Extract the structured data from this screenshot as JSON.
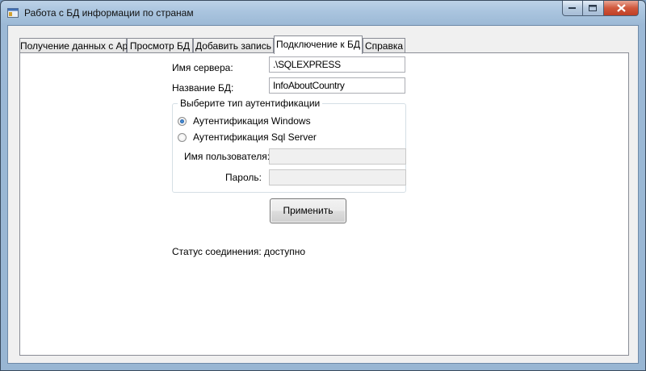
{
  "window": {
    "title": "Работа с БД информации по странам"
  },
  "tabs": [
    {
      "label": "Получение данных с Api"
    },
    {
      "label": "Просмотр БД"
    },
    {
      "label": "Добавить запись"
    },
    {
      "label": "Подключение к БД"
    },
    {
      "label": "Справка"
    }
  ],
  "form": {
    "server_label": "Имя сервера:",
    "server_value": ".\\SQLEXPRESS",
    "db_label": "Название БД:",
    "db_value": "InfoAboutCountry",
    "auth_group_title": "Выберите тип аутентификации",
    "auth_windows_label": "Аутентификация Windows",
    "auth_sql_label": "Аутентификация Sql Server",
    "auth_selected": "windows",
    "username_label": "Имя пользователя:",
    "username_value": "",
    "password_label": "Пароль:",
    "password_value": "",
    "apply_button": "Применить",
    "status_text": "Статус соединения: доступно"
  }
}
